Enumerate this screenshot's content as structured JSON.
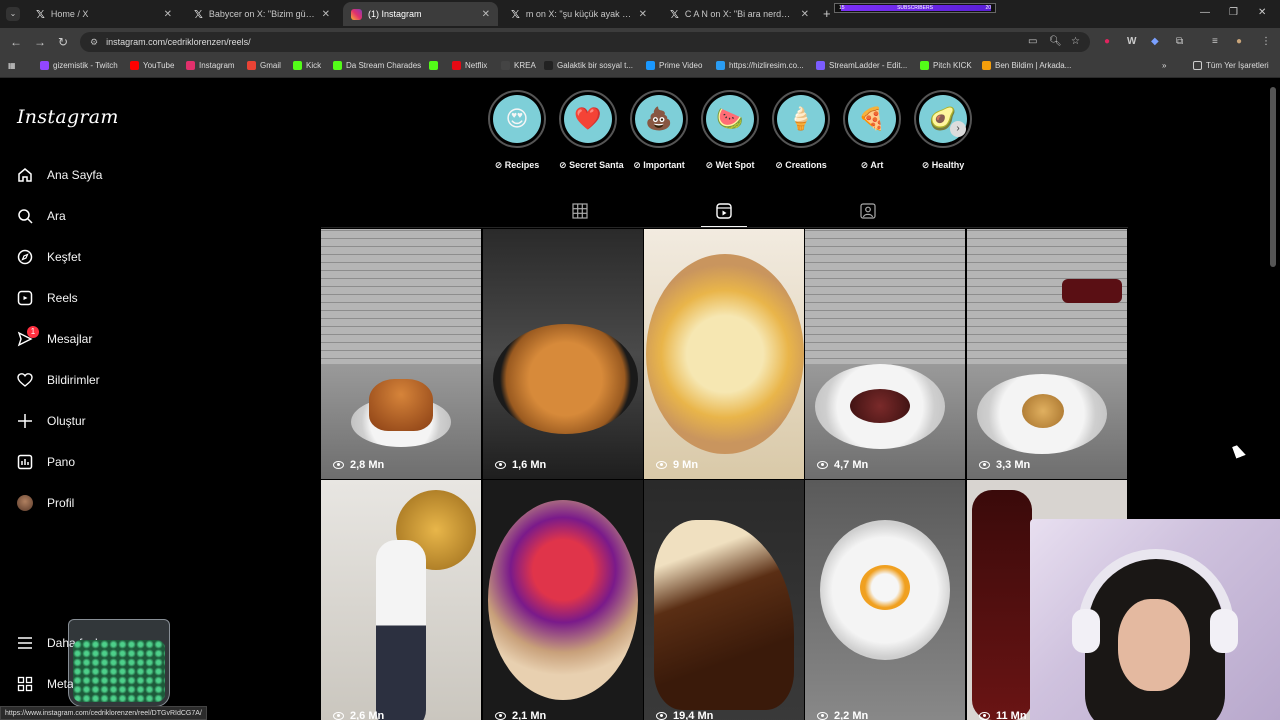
{
  "browser": {
    "tabs": [
      {
        "label": "Home / X",
        "icon": "x-logo"
      },
      {
        "label": "Babycer on X: \"Bizim güven yer",
        "icon": "x-logo"
      },
      {
        "label": "(1) Instagram",
        "icon": "instagram-logo",
        "active": true
      },
      {
        "label": "m on X: \"şu küçük ayak hareket",
        "icon": "x-logo"
      },
      {
        "label": "C A N on X: \"Bi ara nerdeyse tü",
        "icon": "x-logo"
      }
    ],
    "subscribers_overlay": {
      "left": "15",
      "label": "SUBSCRIBERS",
      "right": "20"
    },
    "url": "instagram.com/cedriklorenzen/reels/",
    "bookmarks": [
      {
        "label": "gizemistik - Twitch",
        "color": "#9146ff"
      },
      {
        "label": "YouTube",
        "color": "#ff0000"
      },
      {
        "label": "Instagram",
        "color": "#e1306c"
      },
      {
        "label": "Gmail",
        "color": "#ea4335"
      },
      {
        "label": "Kick",
        "color": "#53fc18"
      },
      {
        "label": "Da Stream Charades",
        "color": "#53fc18"
      },
      {
        "label": "",
        "color": "#53fc18"
      },
      {
        "label": "Netflix",
        "color": "#e50914"
      },
      {
        "label": "KREA",
        "color": "#444444"
      },
      {
        "label": "Galaktik bir sosyal t...",
        "color": "#222222"
      },
      {
        "label": "Prime Video",
        "color": "#1a98ff"
      },
      {
        "label": "https://hizliresim.co...",
        "color": "#2a9df4"
      },
      {
        "label": "StreamLadder - Edit...",
        "color": "#7b5cff"
      },
      {
        "label": "Pitch KICK",
        "color": "#53fc18"
      },
      {
        "label": "Ben Bildim | Arkada...",
        "color": "#f59e0b"
      }
    ],
    "all_bookmarks_label": "Tüm Yer İşaretleri",
    "status_url": "https://www.instagram.com/cedriklorenzen/reel/DTGvRIdCG7A/"
  },
  "instagram": {
    "logo": "Instagram",
    "nav": [
      {
        "label": "Ana Sayfa",
        "icon": "home-icon"
      },
      {
        "label": "Ara",
        "icon": "search-icon"
      },
      {
        "label": "Keşfet",
        "icon": "compass-icon"
      },
      {
        "label": "Reels",
        "icon": "reels-icon"
      },
      {
        "label": "Mesajlar",
        "icon": "messenger-icon",
        "badge": "1"
      },
      {
        "label": "Bildirimler",
        "icon": "heart-icon"
      },
      {
        "label": "Oluştur",
        "icon": "plus-icon"
      },
      {
        "label": "Pano",
        "icon": "dashboard-icon"
      },
      {
        "label": "Profil",
        "icon": "avatar"
      }
    ],
    "more_label": "Daha fazla",
    "meta_label": "Meta",
    "highlights": [
      {
        "label": "Recipes",
        "emoji": "😍"
      },
      {
        "label": "Secret Santa",
        "emoji": "❤️"
      },
      {
        "label": "Important",
        "emoji": "💩"
      },
      {
        "label": "Wet Spot",
        "emoji": "🍉"
      },
      {
        "label": "Creations",
        "emoji": "🍦"
      },
      {
        "label": "Art",
        "emoji": "🍕"
      },
      {
        "label": "Healthy",
        "emoji": "🥑"
      }
    ],
    "highlight_marker": "⊘",
    "reels": [
      {
        "views": "2,8 Mn",
        "subject": "burger"
      },
      {
        "views": "1,6 Mn",
        "subject": "pie"
      },
      {
        "views": "9 Mn",
        "subject": "meringue-tart"
      },
      {
        "views": "4,7 Mn",
        "subject": "steak-plate"
      },
      {
        "views": "3,3 Mn",
        "subject": "pasta-plate"
      },
      {
        "views": "2,6 Mn",
        "subject": "cheese-wheel"
      },
      {
        "views": "2,1 Mn",
        "subject": "berry-tart"
      },
      {
        "views": "19,4 Mn",
        "subject": "chocolate-tart"
      },
      {
        "views": "2,2 Mn",
        "subject": "dessert-bowl"
      },
      {
        "views": "11 Mn",
        "subject": "chocolate-drip"
      }
    ]
  }
}
